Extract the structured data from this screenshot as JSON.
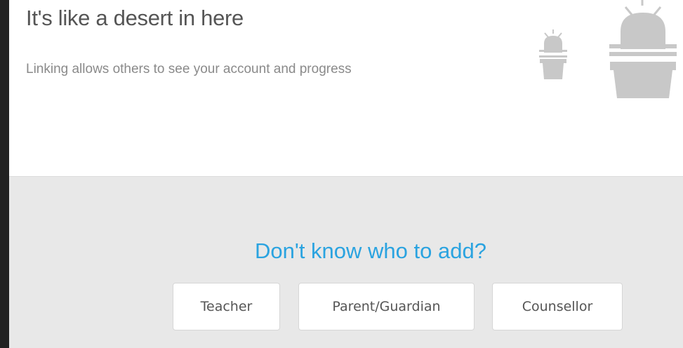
{
  "empty_state": {
    "title": "It's like a desert in here",
    "description": "Linking allows others to see your account and progress",
    "illustration": "cactus-icon"
  },
  "suggestions": {
    "prompt": "Don't know who to add?",
    "buttons": [
      {
        "label": "Teacher"
      },
      {
        "label": "Parent/Guardian"
      },
      {
        "label": "Counsellor"
      }
    ]
  },
  "colors": {
    "accent": "#2aa3e0",
    "illustration": "#c8c8c8",
    "section_background": "#e8e8e8",
    "window_background": "#222222"
  }
}
